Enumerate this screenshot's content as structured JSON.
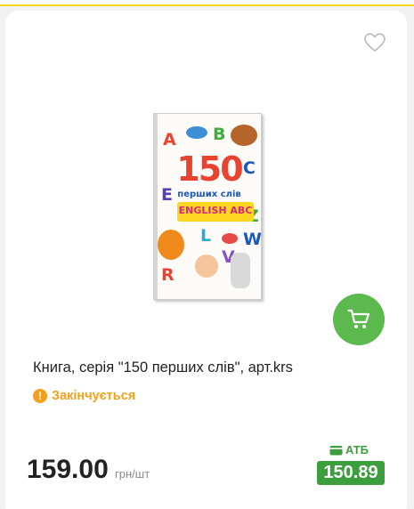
{
  "product": {
    "title": "Книга, серія \"150 перших слів\", арт.krs",
    "image_alt": "Книга 150 перших слів English ABC",
    "stock_status": "Закінчується",
    "price": "159.00",
    "unit": "грн/шт",
    "promo": {
      "store": "АТБ",
      "price": "150.89"
    }
  },
  "cover": {
    "number": "150",
    "subtitle": "перших слів",
    "banner": "ENGLISH ABC",
    "letters": [
      "A",
      "B",
      "C",
      "E",
      "Z",
      "L",
      "W",
      "V",
      "R"
    ]
  },
  "colors": {
    "accent_green": "#5bb94e",
    "promo_green": "#3d9e3e",
    "warning_orange": "#f5a01a",
    "top_stripe": "#f4d41c"
  },
  "icons": {
    "favorite": "heart-outline-icon",
    "cart": "shopping-cart-icon",
    "stock": "exclamation-circle-icon",
    "promo": "wallet-icon"
  }
}
